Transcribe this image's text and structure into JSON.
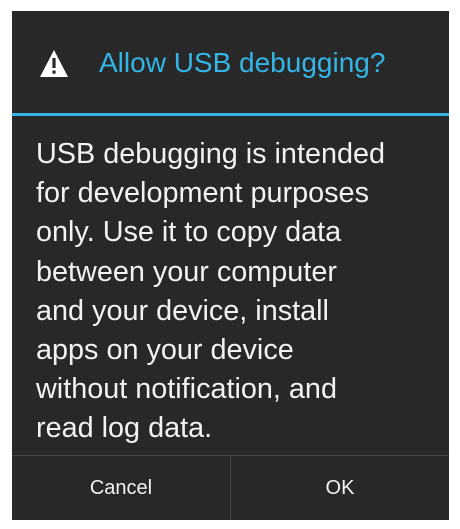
{
  "dialog": {
    "title": "Allow USB debugging?",
    "icon": "warning-icon",
    "accent_color": "#33b5e5",
    "message_lines": [
      "USB debugging is intended",
      "for development purposes",
      "only. Use it to copy data",
      "between your computer",
      "and your device, install",
      "apps on your device",
      "without notification, and",
      "read log data."
    ],
    "buttons": {
      "cancel_label": "Cancel",
      "ok_label": "OK"
    }
  }
}
